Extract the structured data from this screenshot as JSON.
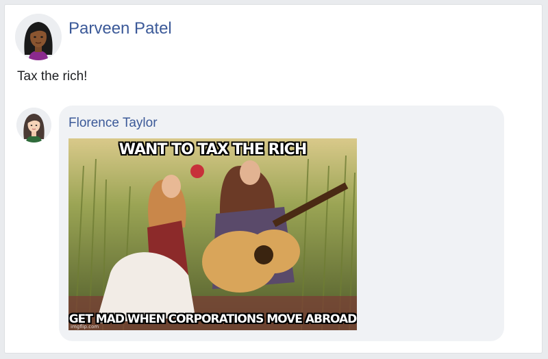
{
  "post": {
    "author": "Parveen Patel",
    "text": "Tax the rich!"
  },
  "comment": {
    "author": "Florence Taylor",
    "meme": {
      "top_text": "WANT TO TAX THE RICH",
      "bottom_text": "GET MAD WHEN CORPORATIONS MOVE ABROAD",
      "watermark": "imgflip.com"
    }
  },
  "colors": {
    "link": "#3b5998",
    "bubble": "#f0f2f5",
    "background": "#e9ebee"
  }
}
